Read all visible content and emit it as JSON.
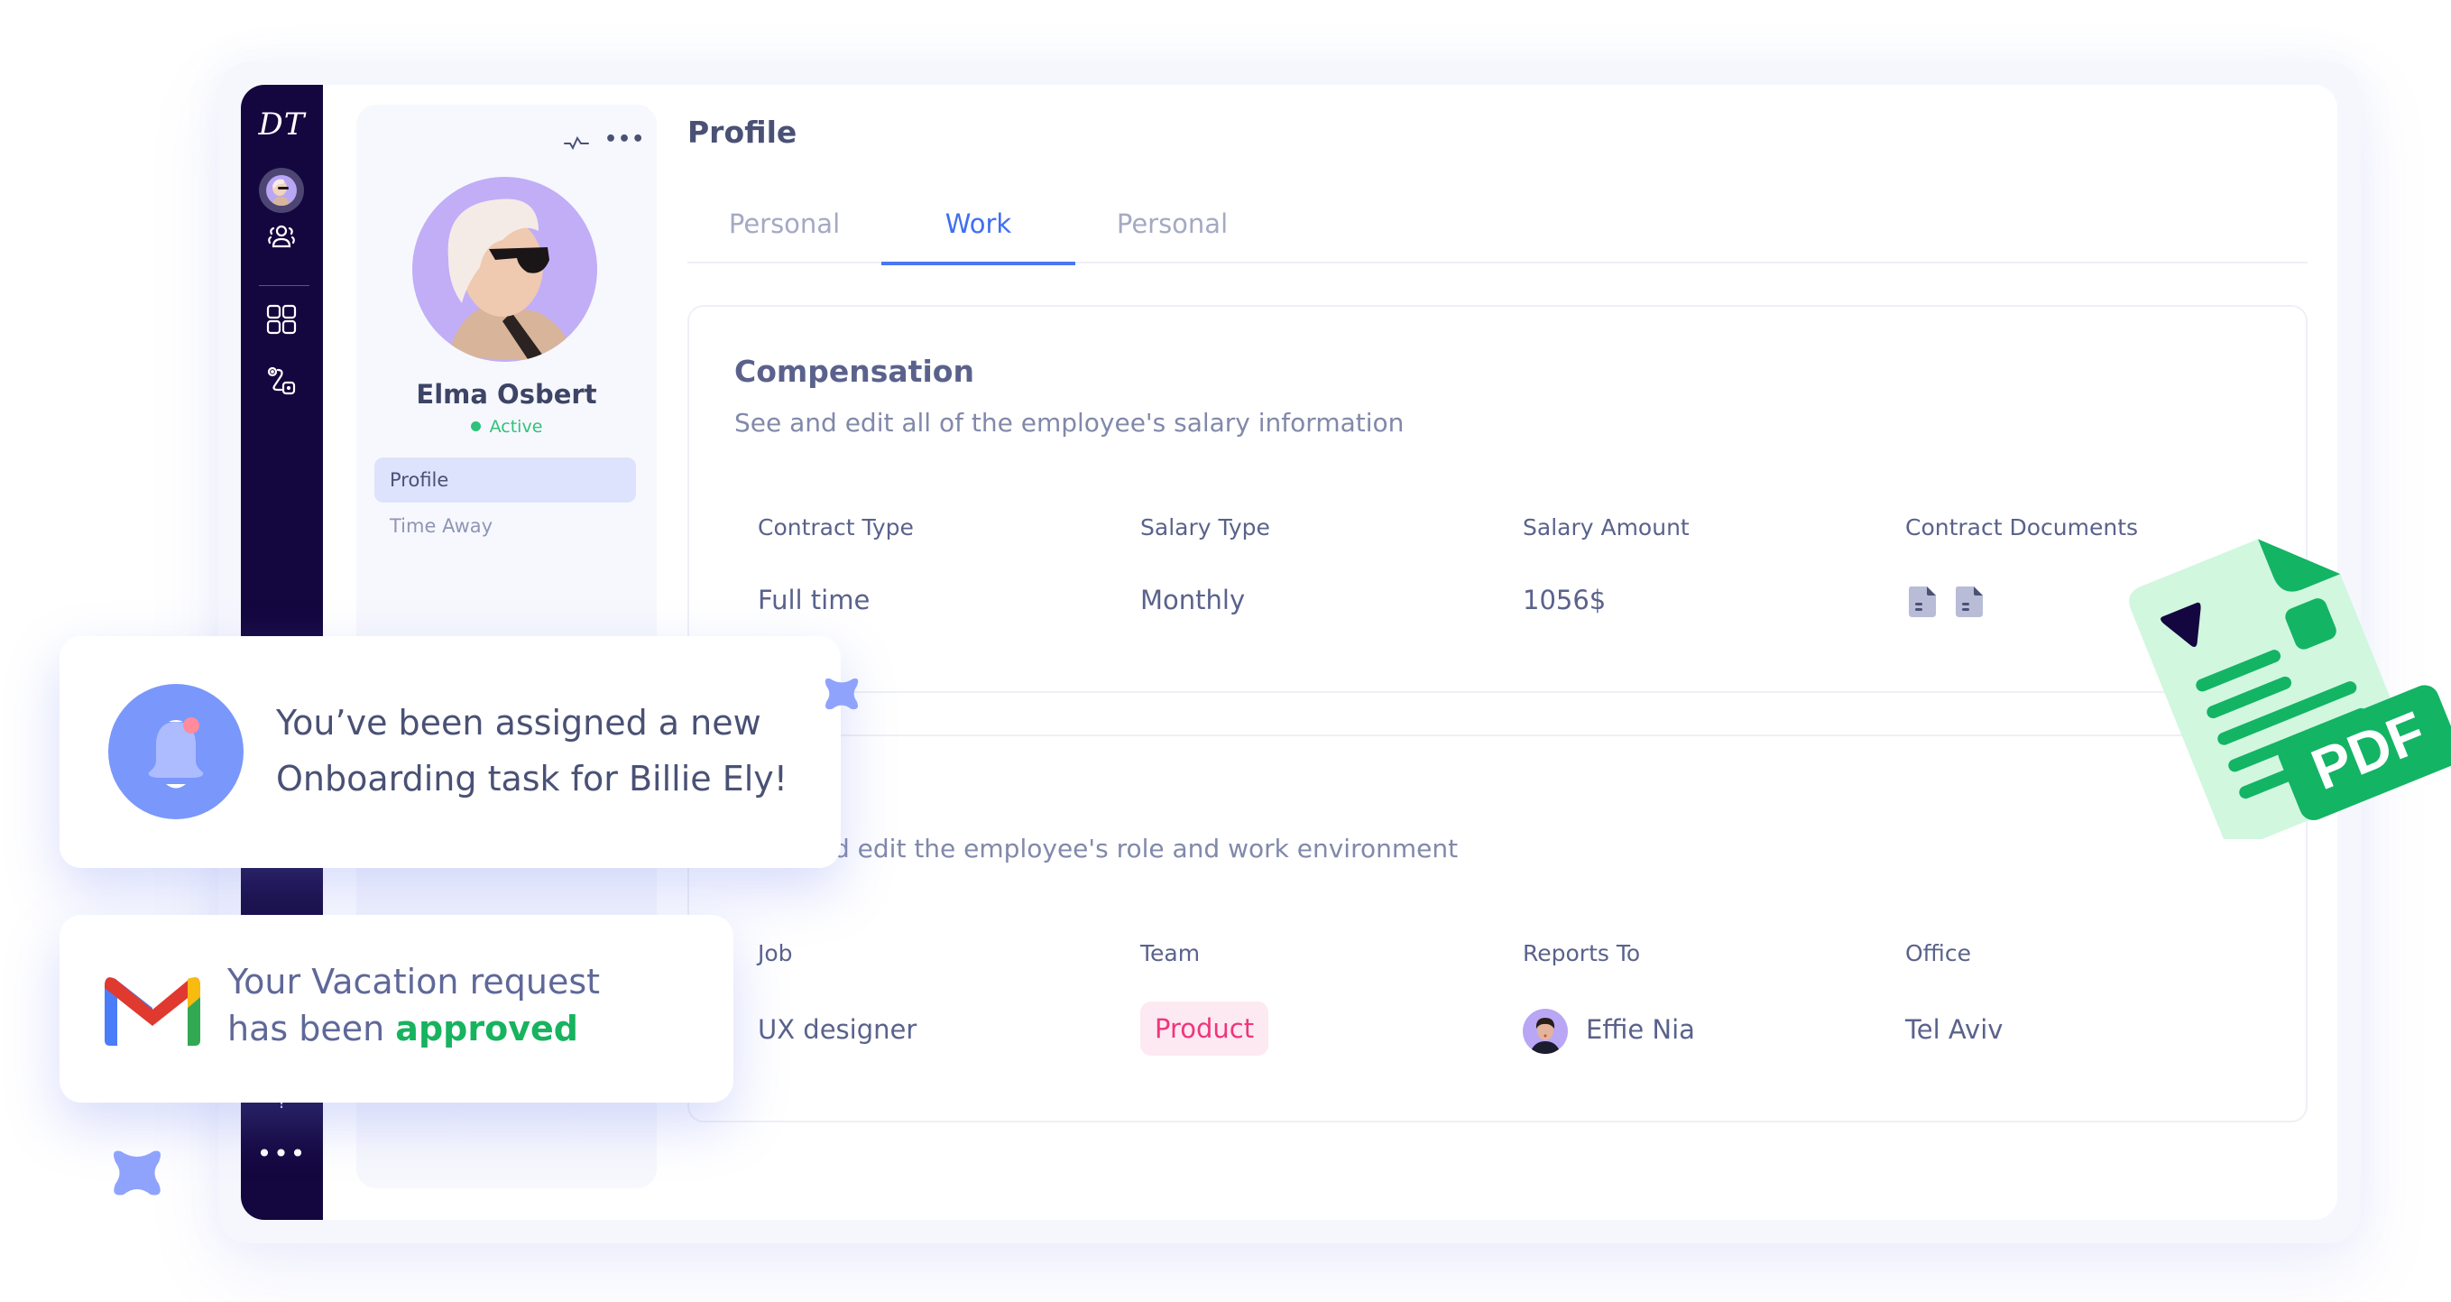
{
  "app": {
    "logo": "DT"
  },
  "sidebar": {
    "items": [
      {
        "name": "current-user-avatar"
      },
      {
        "name": "people-icon"
      },
      {
        "name": "apps-grid-icon"
      },
      {
        "name": "workflow-icon"
      }
    ],
    "help_label": "?",
    "more_label": "•••"
  },
  "profile_panel": {
    "name": "Elma Osbert",
    "status": "Active",
    "status_color": "#2fc27b",
    "nav": [
      {
        "label": "Profile",
        "active": true
      },
      {
        "label": "Time Away",
        "active": false
      }
    ]
  },
  "header": {
    "title": "Profile"
  },
  "tabs": [
    {
      "label": "Personal",
      "active": false
    },
    {
      "label": "Work",
      "active": true
    },
    {
      "label": "Personal",
      "active": false
    }
  ],
  "compensation": {
    "title": "Compensation",
    "subtitle": "See and edit all of the employee's salary information",
    "columns": [
      "Contract Type",
      "Salary Type",
      "Salary Amount",
      "Contract Documents"
    ],
    "values": {
      "contract_type": "Full time",
      "salary_type": "Monthly",
      "salary_amount": "1056$",
      "documents": [
        "document-icon",
        "document-icon"
      ]
    }
  },
  "job": {
    "subtitle_visible": "d edit the employee's role and work environment",
    "columns": [
      "Job",
      "Team",
      "Reports To",
      "Office"
    ],
    "values": {
      "job": "UX designer",
      "team": "Product",
      "reports_to": "Effie Nia",
      "office": "Tel Aviv"
    }
  },
  "notifications": [
    {
      "icon": "bell-icon",
      "line1": "You’ve been assigned a new",
      "line2": "Onboarding task for Billie Ely!"
    },
    {
      "icon": "gmail-icon",
      "line1": "Your Vacation request",
      "line2_prefix": "has been ",
      "line2_highlight": "approved",
      "highlight_color": "#17b35f"
    }
  ],
  "pdf_badge": {
    "label": "PDF"
  },
  "colors": {
    "sidebar": "#14073f",
    "accent": "#3f6ff0",
    "team_chip_bg": "#fde9f1",
    "team_chip_text": "#f0357a",
    "pdf_green": "#13b464"
  }
}
